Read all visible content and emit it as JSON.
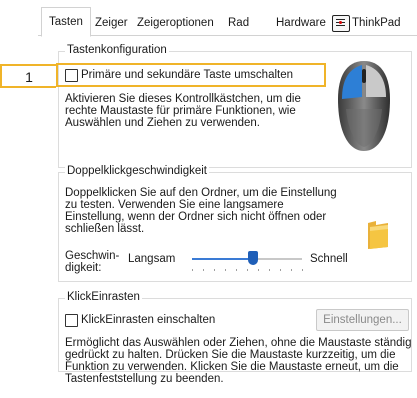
{
  "tabs": [
    {
      "label": "Tasten",
      "active": true
    },
    {
      "label": "Zeiger"
    },
    {
      "label": "Zeigeroptionen"
    },
    {
      "label": "Rad"
    },
    {
      "label": "Hardware"
    },
    {
      "label": "ThinkPad",
      "icon": "thinkpad-icon"
    }
  ],
  "callout_number": "1",
  "button_config": {
    "title": "Tastenkonfiguration",
    "checkbox_label": "Primäre und sekundäre Taste umschalten",
    "checked": false,
    "description": [
      "Aktivieren Sie dieses Kontrollkästchen, um die",
      "rechte Maustaste für primäre Funktionen, wie",
      "Auswählen und Ziehen zu verwenden."
    ],
    "image": "mouse-icon"
  },
  "double_click": {
    "title": "Doppelklickgeschwindigkeit",
    "description": [
      "Doppelklicken Sie auf den Ordner, um die Einstellung",
      "zu testen. Verwenden Sie eine langsamere",
      "Einstellung, wenn der Ordner sich nicht öffnen oder",
      "schließen lässt."
    ],
    "speed_label": [
      "Geschwin-",
      "digkeit:"
    ],
    "slow_label": "Langsam",
    "fast_label": "Schnell",
    "speed_value": 0.55,
    "image": "folder-icon"
  },
  "click_lock": {
    "title": "KlickEinrasten",
    "checkbox_label": "KlickEinrasten einschalten",
    "checked": false,
    "settings_button": "Einstellungen...",
    "description": [
      "Ermöglicht das Auswählen oder Ziehen, ohne die Maustaste ständig",
      "gedrückt zu halten. Drücken Sie die Maustaste kurzzeitig, um die",
      "Funktion zu verwenden. Klicken Sie die Maustaste erneut, um die",
      "Tastenfeststellung zu beenden."
    ]
  },
  "colors": {
    "callout": "#f0b429",
    "slider": "#1f5fb8",
    "folder": "#f5c542"
  }
}
